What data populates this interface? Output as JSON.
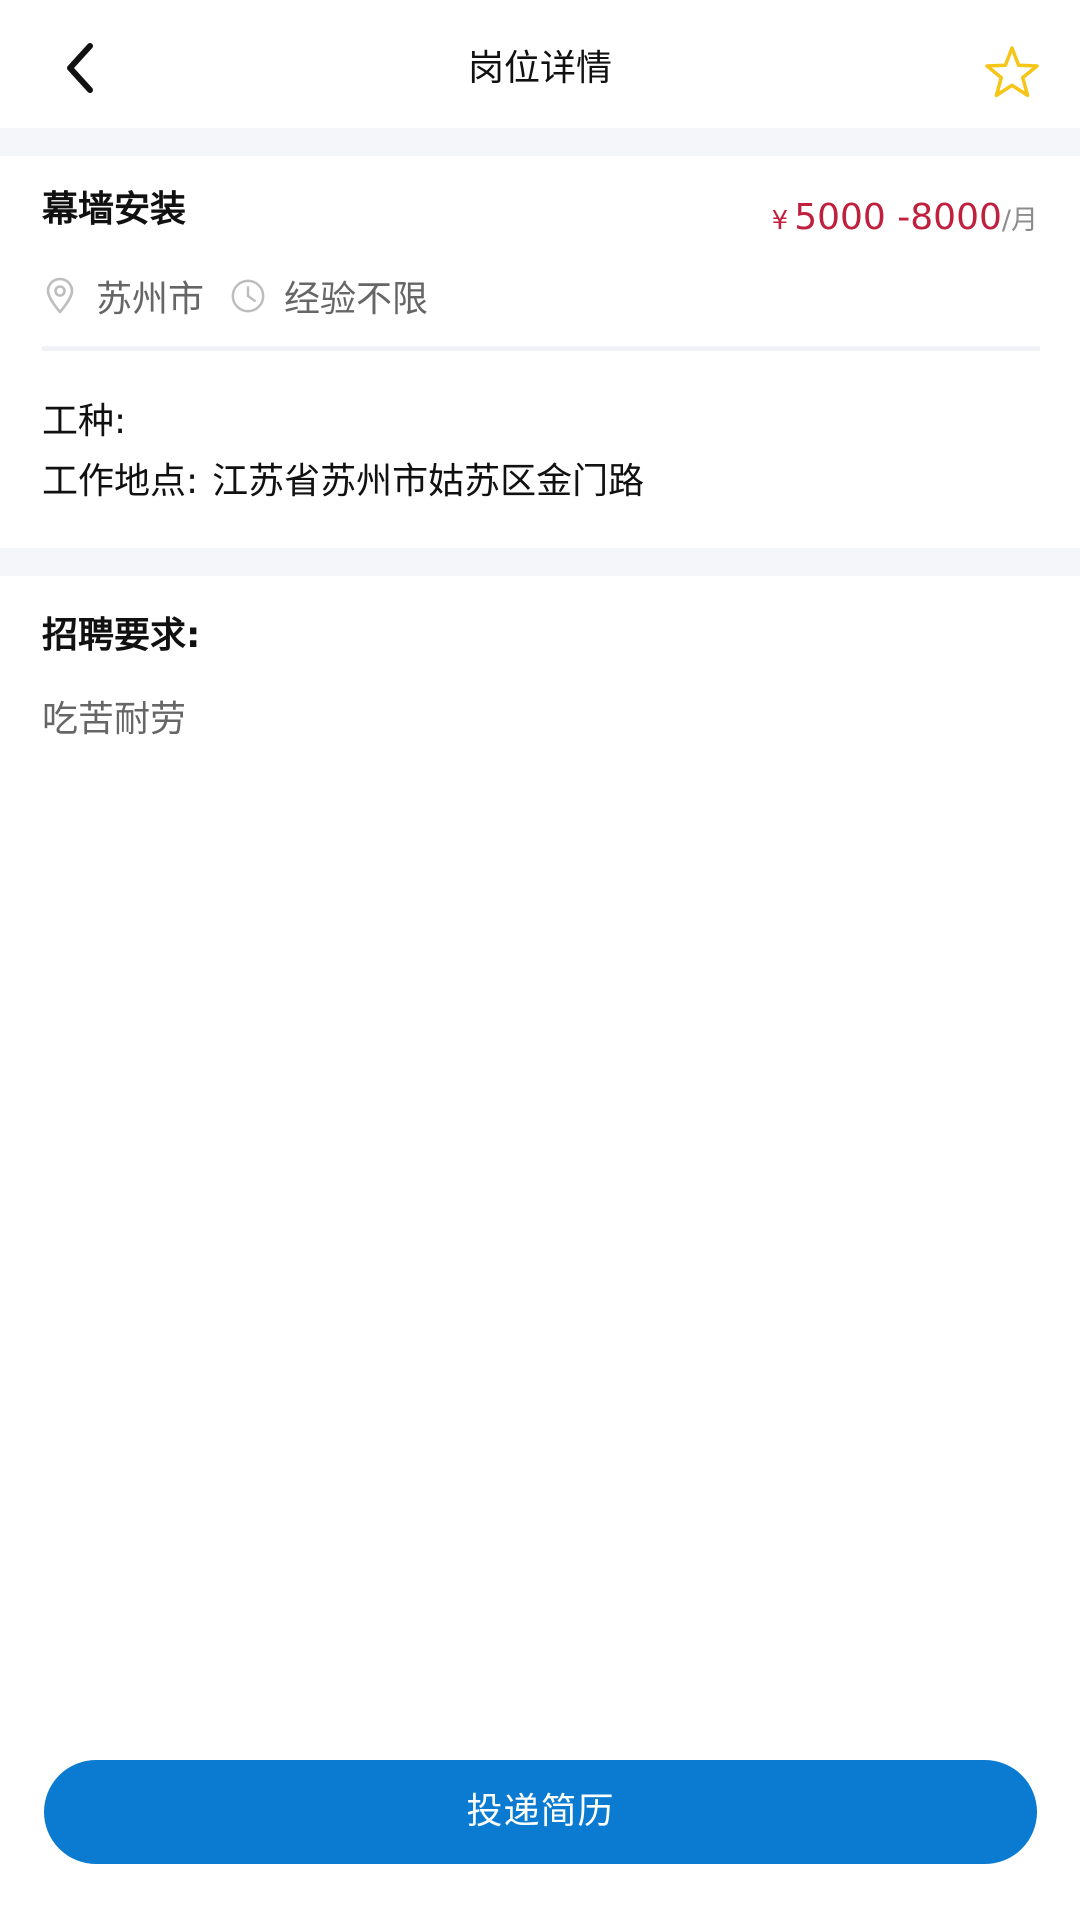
{
  "navbar": {
    "title": "岗位详情",
    "back_icon": "chevron-left-icon",
    "favorite_icon": "star-outline-icon",
    "favorite_color": "#f5c518"
  },
  "job": {
    "title": "幕墙安装",
    "salary": {
      "currency": "¥",
      "range": "5000 -8000",
      "unit": "/月",
      "color": "#c0203e"
    },
    "city": "苏州市",
    "city_icon": "location-pin-icon",
    "experience": "经验不限",
    "experience_icon": "clock-icon",
    "work_type_label": "工种:",
    "work_type_value": "",
    "location_label": "工作地点:",
    "location_value": "江苏省苏州市姑苏区金门路"
  },
  "requirements": {
    "heading": "招聘要求:",
    "text": "吃苦耐劳"
  },
  "apply_button": {
    "label": "投递简历",
    "color": "#0a7bd0"
  }
}
